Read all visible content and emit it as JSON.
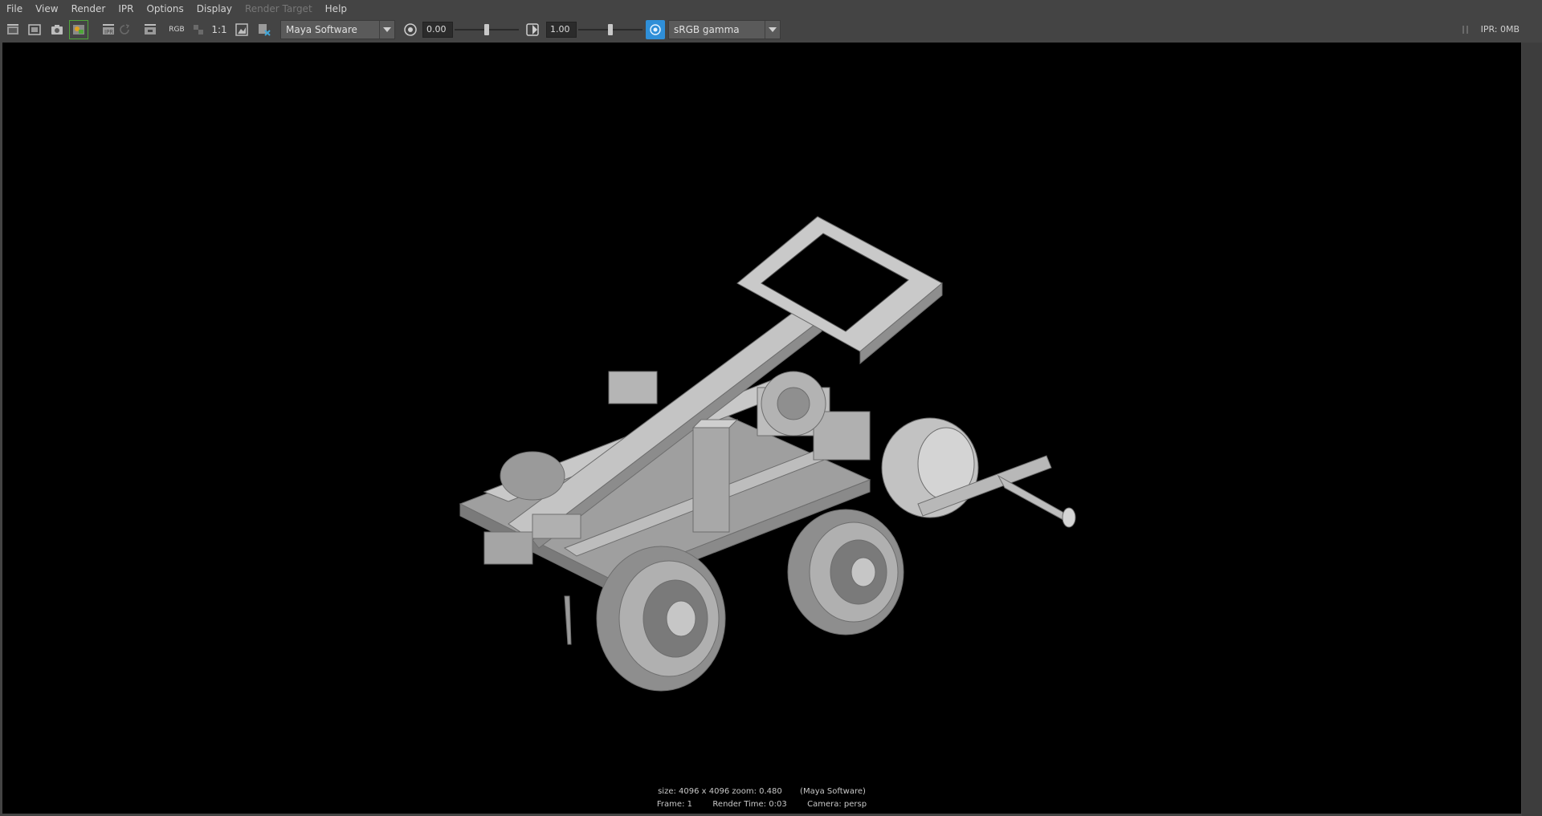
{
  "menubar": {
    "items": [
      {
        "label": "File",
        "enabled": true
      },
      {
        "label": "View",
        "enabled": true
      },
      {
        "label": "Render",
        "enabled": true
      },
      {
        "label": "IPR",
        "enabled": true
      },
      {
        "label": "Options",
        "enabled": true
      },
      {
        "label": "Display",
        "enabled": true
      },
      {
        "label": "Render Target",
        "enabled": false
      },
      {
        "label": "Help",
        "enabled": true
      }
    ]
  },
  "toolbar": {
    "icons": [
      "redo-render-icon",
      "render-region-icon",
      "snapshot-icon",
      "keep-image-icon",
      "remove-image-icon",
      "ipr-render-icon",
      "refresh-ipr-icon"
    ],
    "rgb_label": "RGB",
    "one_to_one_label": "1:1",
    "renderer": "Maya Software",
    "exposure": "0.00",
    "exposure_level": 0.5,
    "gamma": "1.00",
    "gamma_level": 0.5,
    "color_space": "sRGB gamma",
    "accent_color": "#2f8fd8",
    "active_green": "#4fa63a"
  },
  "ipr_status": "IPR: 0MB",
  "render_info": {
    "size_zoom": "size: 4096 x 4096 zoom: 0.480",
    "renderer_paren": "(Maya Software)",
    "frame": "Frame: 1",
    "render_time": "Render Time: 0:03",
    "camera": "Camera: persp"
  }
}
